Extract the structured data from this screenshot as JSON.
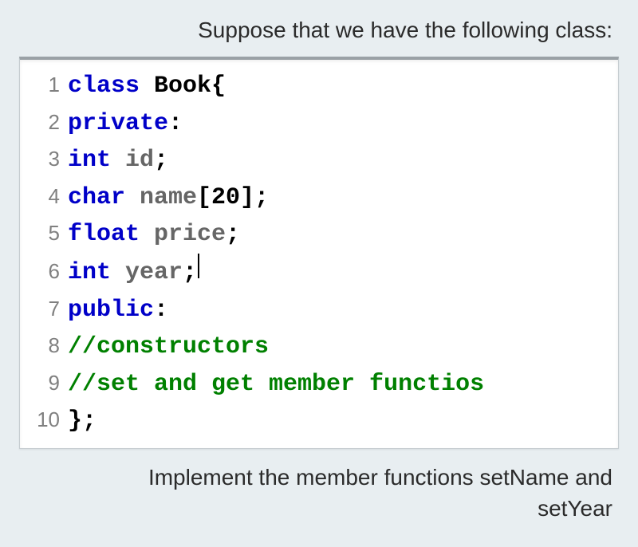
{
  "prompt_top": "Suppose that we have the following class:",
  "prompt_bottom_line1": "Implement the member functions setName and",
  "prompt_bottom_line2": "setYear",
  "code": {
    "ln1": "1",
    "ln2": "2",
    "ln3": "3",
    "ln4": "4",
    "ln5": "5",
    "ln6": "6",
    "ln7": "7",
    "ln8": "8",
    "ln9": "9",
    "ln10": "10",
    "l1_kw": "class",
    "l1_sp": " ",
    "l1_name": "Book",
    "l1_brace": "{",
    "l2_kw": "private",
    "l2_colon": ":",
    "l3_kw": "int",
    "l3_sp": " ",
    "l3_id": "id",
    "l3_semi": ";",
    "l4_kw": "char",
    "l4_sp": " ",
    "l4_id": "name",
    "l4_br": "[20];",
    "l5_kw": "float",
    "l5_sp": " ",
    "l5_id": "price",
    "l5_semi": ";",
    "l6_kw": "int",
    "l6_sp": " ",
    "l6_id": "year",
    "l6_semi": ";",
    "l7_kw": "public",
    "l7_colon": ":",
    "l8_cmt": "//constructors",
    "l9_cmt": "//set and get member functios",
    "l10_brace": "}",
    "l10_semi": ";"
  }
}
